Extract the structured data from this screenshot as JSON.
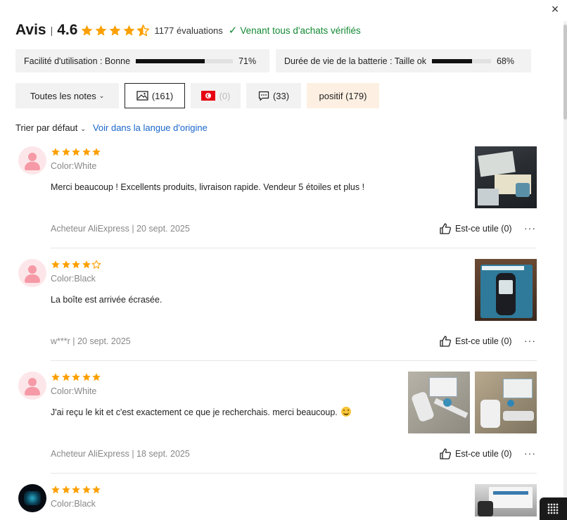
{
  "header": {
    "title": "Avis",
    "separator": "|",
    "score": "4.6",
    "rating": 4.6,
    "count": "1177 évaluations",
    "verified": "Venant tous d'achats vérifiés"
  },
  "stats": [
    {
      "label": "Facilité d'utilisation : Bonne",
      "percent": "71%",
      "value": 71
    },
    {
      "label": "Durée de vie de la batterie : Taille ok",
      "percent": "68%",
      "value": 68
    }
  ],
  "filters": {
    "all_notes": "Toutes les notes",
    "photos": "(161)",
    "local": "(0)",
    "comments": "(33)",
    "positive": "positif (179)"
  },
  "sort": {
    "label": "Trier par défaut",
    "original_language": "Voir dans la langue d'origine"
  },
  "reviews": [
    {
      "stars": 5,
      "color": "Color:White",
      "text": "Merci beaucoup ! Excellents produits, livraison rapide. Vendeur 5 étoiles et plus !",
      "author": "Acheteur AliExpress | 20 sept. 2025",
      "helpful": "Est-ce utile (0)",
      "more": "···"
    },
    {
      "stars": 4,
      "color": "Color:Black",
      "text": "La boîte est arrivée écrasée.",
      "author": "w***r | 20 sept. 2025",
      "helpful": "Est-ce utile (0)",
      "more": "···"
    },
    {
      "stars": 5,
      "color": "Color:White",
      "text": "J'ai reçu le kit et c'est exactement ce que je recherchais. merci beaucoup.",
      "author": "Acheteur AliExpress | 18 sept. 2025",
      "helpful": "Est-ce utile (0)",
      "more": "···"
    },
    {
      "stars": 5,
      "color": "Color:Black"
    }
  ],
  "colors": {
    "star": "#fca000",
    "verified_green": "#148a34",
    "link_blue": "#1a66cc",
    "positive_bg": "#fdf0e2",
    "flag_red": "#e60012"
  },
  "icons": {
    "close": "×",
    "chevron": "⌄"
  }
}
